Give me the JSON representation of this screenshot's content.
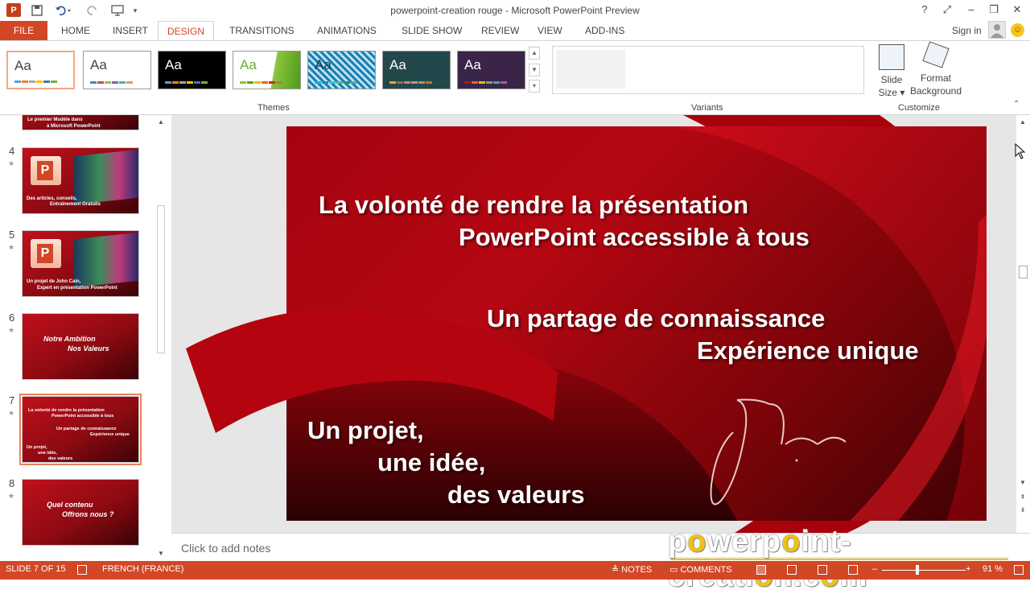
{
  "window": {
    "title": "powerpoint-creation rouge - Microsoft PowerPoint Preview",
    "help": "?",
    "restore_ribbon": "⤢",
    "minimize": "–",
    "maximize": "❐",
    "close": "✕"
  },
  "quick_access": {
    "app_icon": "P",
    "save_icon": "save-icon",
    "undo_icon": "undo-icon",
    "redo_icon": "redo-icon",
    "present_icon": "present-icon",
    "customize_icon": "chevron-down-icon"
  },
  "tabs": [
    "FILE",
    "HOME",
    "INSERT",
    "DESIGN",
    "TRANSITIONS",
    "ANIMATIONS",
    "SLIDE SHOW",
    "REVIEW",
    "VIEW",
    "ADD-INS"
  ],
  "active_tab": "DESIGN",
  "account": {
    "signin": "Sign in",
    "smiley": "☺"
  },
  "ribbon": {
    "themes_label": "Themes",
    "variants_label": "Variants",
    "customize_label": "Customize",
    "theme_sample": "Aa",
    "slide_size": "Slide Size ▾",
    "slide_size_line1": "Slide",
    "slide_size_line2": "Size ▾",
    "format_bg_line1": "Format",
    "format_bg_line2": "Background",
    "colors": {
      "accent": "#d24726",
      "office_orange": "#d24726"
    }
  },
  "slides_panel": {
    "thumbnails": [
      {
        "num": "4",
        "line1": "Des articles, conseils,",
        "line2": "Entraînement Gratuits"
      },
      {
        "num": "5",
        "line1": "Un projet de John Cain,",
        "line2": "Expert en présentation PowerPoint"
      },
      {
        "num": "6",
        "line1": "Notre Ambition",
        "line2": "Nos Valeurs"
      },
      {
        "num": "7",
        "line1": "La volonté de rendre la présentation",
        "line2": "PowerPoint accessible à tous",
        "line3": "Un partage de connaissance",
        "line4": "Expérience unique",
        "line5": "Un projet,",
        "line6": "une idée,",
        "line7": "des valeurs"
      },
      {
        "num": "8",
        "line1": "Quel contenu",
        "line2": "Offrons nous ?"
      }
    ],
    "partial_top": {
      "line1": "Le premier Modèle dans",
      "line2": "à Microsoft PowerPoint"
    }
  },
  "slide": {
    "line1": "La volonté de rendre la présentation",
    "line2": "PowerPoint accessible à tous",
    "line3": "Un partage de connaissance",
    "line4": "Expérience unique",
    "line5": "Un projet,",
    "line6": "une idée,",
    "line7": "des valeurs",
    "bg_color": "#b50712"
  },
  "notes": {
    "placeholder": "Click to add notes"
  },
  "watermark": {
    "pre": "p",
    "o1": "o",
    "mid1": "werp",
    "o2": "o",
    "mid2": "int-creati",
    "o3": "o",
    "mid3": "n.c",
    "o4": "o",
    "post": "m"
  },
  "status": {
    "slide_pos": "SLIDE 7 OF 15",
    "language": "FRENCH (FRANCE)",
    "notes": "NOTES",
    "comments": "COMMENTS",
    "zoom_minus": "–",
    "zoom_plus": "+",
    "zoom": "91 %"
  }
}
